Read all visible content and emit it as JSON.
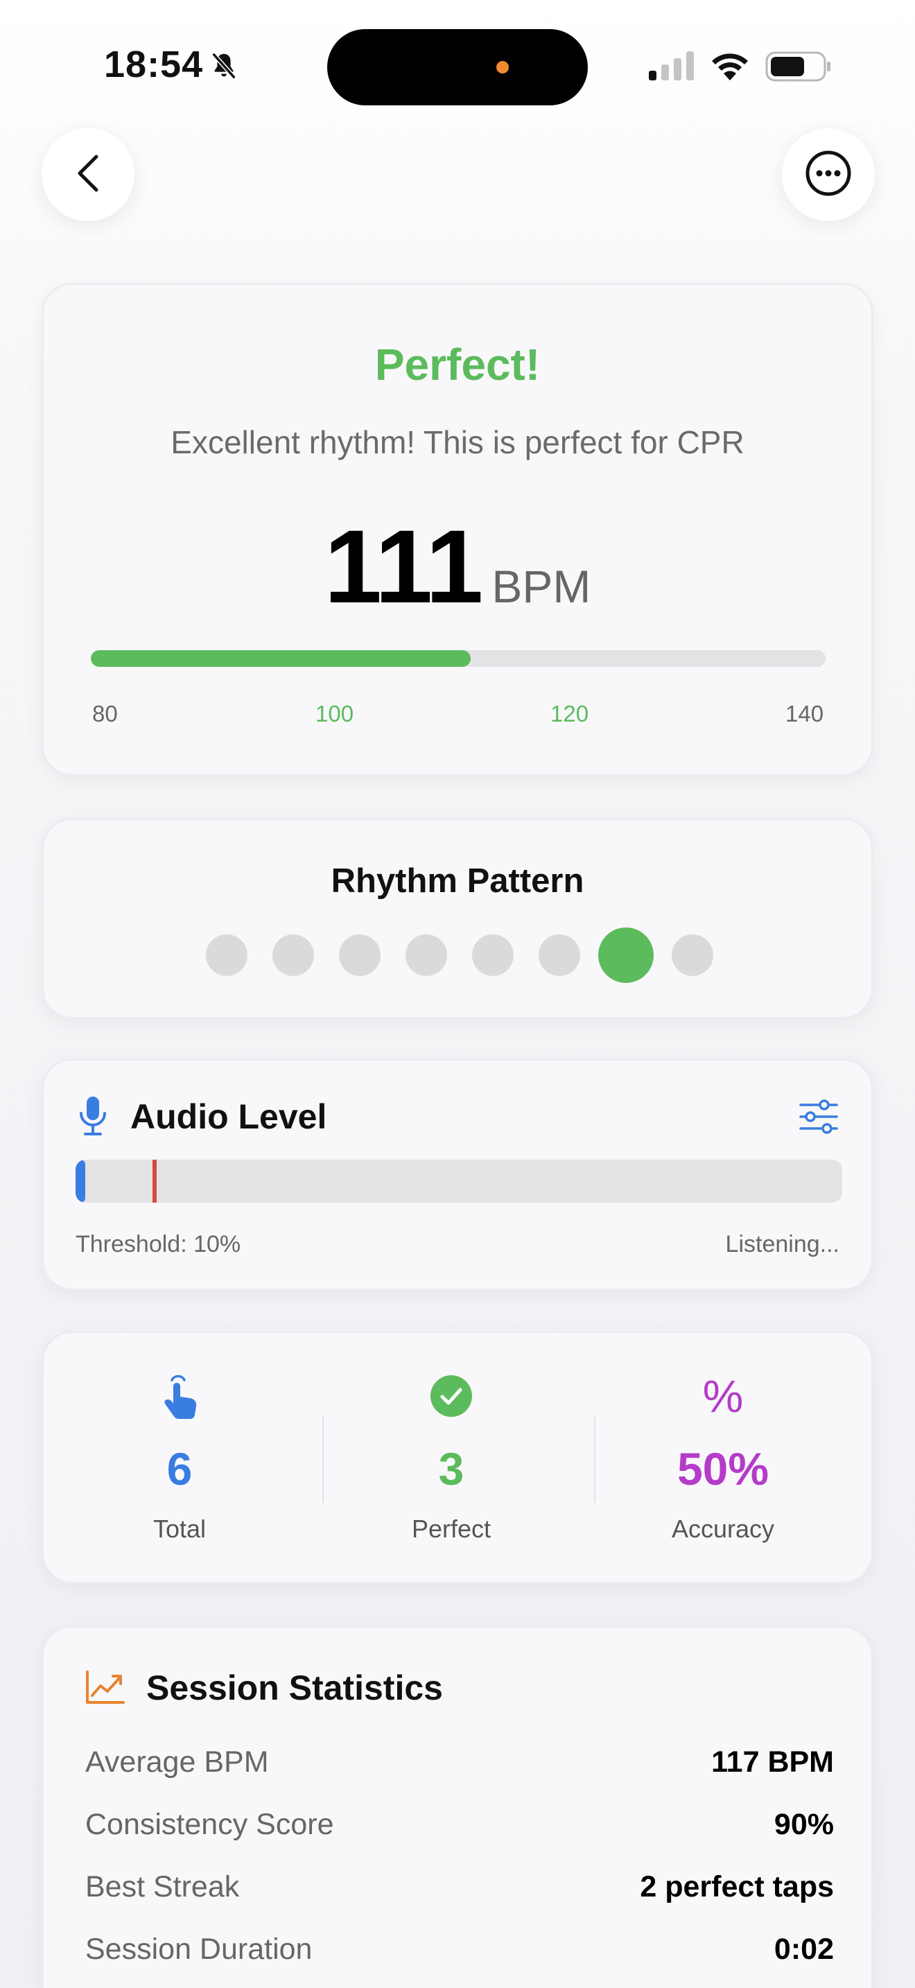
{
  "status_bar": {
    "time": "18:54",
    "icons": [
      "bell-slash-icon",
      "cellular-signal-icon",
      "wifi-icon",
      "battery-icon"
    ]
  },
  "nav": {
    "back_icon": "chevron-left-icon",
    "more_icon": "ellipsis-circle-icon"
  },
  "rate_card": {
    "status": "Perfect!",
    "message": "Excellent rhythm! This is perfect for CPR",
    "bpm": "111",
    "unit": "BPM",
    "scale_min": 80,
    "scale_max": 140,
    "ticks": [
      "80",
      "100",
      "120",
      "140"
    ],
    "colors": {
      "good": "#5cbb5c",
      "track": "#e3e3e6"
    }
  },
  "rhythm_card": {
    "title": "Rhythm Pattern",
    "dot_count": 8,
    "active_index": 6
  },
  "audio_card": {
    "title": "Audio Level",
    "icon": "microphone-icon",
    "settings_icon": "sliders-icon",
    "level_fraction": 0.013,
    "threshold_fraction": 0.1,
    "threshold_label": "Threshold: 10%",
    "status": "Listening...",
    "colors": {
      "level": "#3a7de0",
      "threshold": "#d64a3a"
    }
  },
  "stats_card": {
    "total": {
      "icon": "hand-tap-icon",
      "value": "6",
      "label": "Total",
      "color": "#3a7de0"
    },
    "perfect": {
      "icon": "checkmark-circle-icon",
      "value": "3",
      "label": "Perfect",
      "color": "#5cbb5c"
    },
    "accuracy": {
      "icon": "percent-icon",
      "icon_text": "%",
      "value": "50%",
      "label": "Accuracy",
      "color": "#b43cc8"
    }
  },
  "session_card": {
    "title": "Session Statistics",
    "icon": "chart-trend-up-icon",
    "rows": [
      {
        "label": "Average BPM",
        "value": "117 BPM"
      },
      {
        "label": "Consistency Score",
        "value": "90%"
      },
      {
        "label": "Best Streak",
        "value": "2 perfect taps"
      },
      {
        "label": "Session Duration",
        "value": "0:02"
      }
    ]
  }
}
